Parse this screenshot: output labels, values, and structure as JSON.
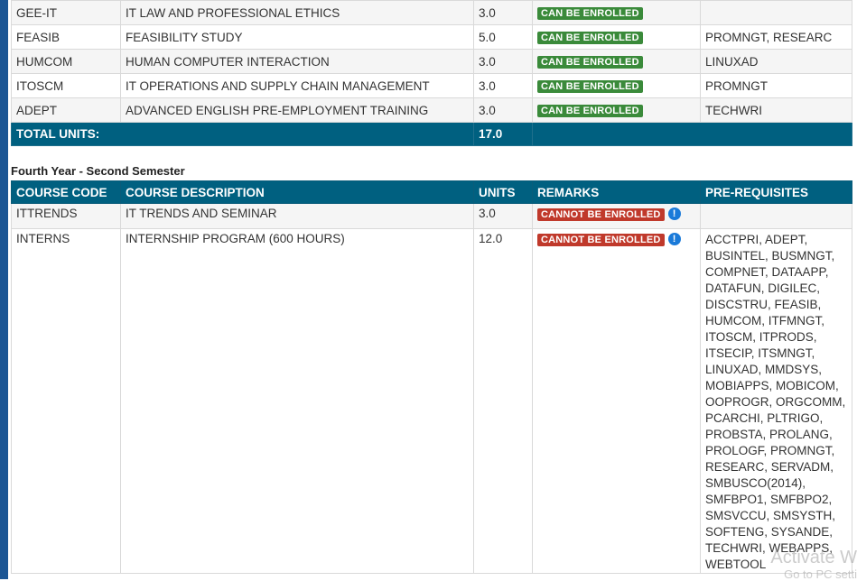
{
  "upper_table": {
    "rows": [
      {
        "code": "GEE-IT",
        "description": "IT LAW AND PROFESSIONAL ETHICS",
        "units": "3.0",
        "remark": "CAN BE ENROLLED",
        "prereq": ""
      },
      {
        "code": "FEASIB",
        "description": "FEASIBILITY STUDY",
        "units": "5.0",
        "remark": "CAN BE ENROLLED",
        "prereq": "PROMNGT, RESEARC"
      },
      {
        "code": "HUMCOM",
        "description": "HUMAN COMPUTER INTERACTION",
        "units": "3.0",
        "remark": "CAN BE ENROLLED",
        "prereq": "LINUXAD"
      },
      {
        "code": "ITOSCM",
        "description": "IT OPERATIONS AND SUPPLY CHAIN MANAGEMENT",
        "units": "3.0",
        "remark": "CAN BE ENROLLED",
        "prereq": "PROMNGT"
      },
      {
        "code": "ADEPT",
        "description": "ADVANCED ENGLISH PRE-EMPLOYMENT TRAINING",
        "units": "3.0",
        "remark": "CAN BE ENROLLED",
        "prereq": "TECHWRI"
      }
    ],
    "total_label": "TOTAL UNITS:",
    "total_units": "17.0"
  },
  "section_title": "Fourth Year - Second Semester",
  "headers": {
    "code": "COURSE CODE",
    "description": "COURSE DESCRIPTION",
    "units": "UNITS",
    "remarks": "REMARKS",
    "prereq": "PRE-REQUISITES"
  },
  "lower_table": {
    "rows": [
      {
        "code": "ITTRENDS",
        "description": "IT TRENDS AND SEMINAR",
        "units": "3.0",
        "remark": "CANNOT BE ENROLLED",
        "info": "!",
        "prereq": ""
      },
      {
        "code": "INTERNS",
        "description": "INTERNSHIP PROGRAM (600 HOURS)",
        "units": "12.0",
        "remark": "CANNOT BE ENROLLED",
        "info": "!",
        "prereq": "ACCTPRI, ADEPT, BUSINTEL, BUSMNGT, COMPNET, DATAAPP, DATAFUN, DIGILEC, DISCSTRU, FEASIB, HUMCOM, ITFMNGT, ITOSCM, ITPRODS, ITSECIP, ITSMNGT, LINUXAD, MMDSYS, MOBIAPPS, MOBICOM, OOPROGR, ORGCOMM, PCARCHI, PLTRIGO, PROBSTA, PROLANG, PROLOGF, PROMNGT, RESEARC, SERVADM, SMBUSCO(2014), SMFBPO1, SMFBPO2, SMSVCCU, SMSYSTH, SOFTENG, SYSANDE, TECHWRI, WEBAPPS, WEBTOOL"
      }
    ]
  },
  "watermark": {
    "line1": "Activate W",
    "line2": "Go to PC setti"
  },
  "colors": {
    "header": "#006080",
    "ok": "#3a8a3a",
    "bad": "#c0392b",
    "info": "#1a7ad9",
    "sidebar": "#1b5594"
  }
}
